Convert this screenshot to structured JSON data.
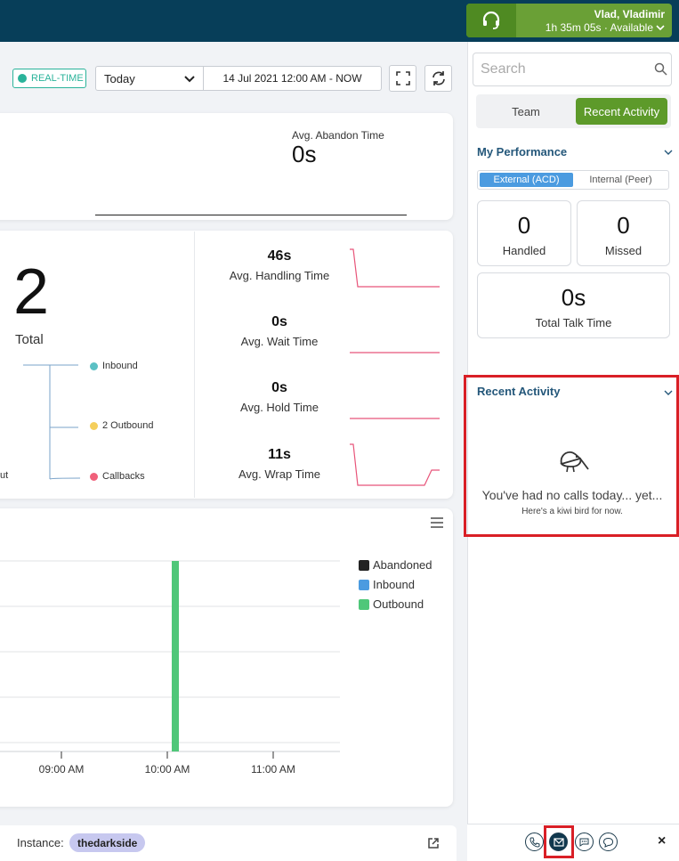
{
  "header": {
    "agent_name": "Vlad, Vladimir",
    "agent_status": "1h 35m 05s · Available"
  },
  "toolbar": {
    "realtime_label": "REAL-TIME",
    "date_preset": "Today",
    "date_range": "14 Jul 2021 12:00 AM - NOW"
  },
  "summary": {
    "abandon_label": "Avg. Abandon Time",
    "abandon_value": "0s"
  },
  "calls": {
    "total_value": "2",
    "total_label": "Total",
    "tree": {
      "inbound": "Inbound",
      "outbound": "2 Outbound",
      "callbacks": "Callbacks",
      "left_partial": "ut"
    },
    "metrics": [
      {
        "value": "46s",
        "label": "Avg. Handling Time"
      },
      {
        "value": "0s",
        "label": "Avg. Wait Time"
      },
      {
        "value": "0s",
        "label": "Avg. Hold Time"
      },
      {
        "value": "11s",
        "label": "Avg. Wrap Time"
      }
    ],
    "colors": {
      "inbound": "#5bc0c4",
      "outbound": "#f5cf5c",
      "callbacks": "#f0607a",
      "sparkline": "#e8557a"
    }
  },
  "chart_data": {
    "type": "bar",
    "categories": [
      "09:00 AM",
      "10:00 AM",
      "11:00 AM"
    ],
    "series": [
      {
        "name": "Abandoned",
        "values": [
          0,
          0,
          0
        ],
        "color": "#222222"
      },
      {
        "name": "Inbound",
        "values": [
          0,
          0,
          0
        ],
        "color": "#4b9be0"
      },
      {
        "name": "Outbound",
        "values": [
          0,
          2,
          0
        ],
        "color": "#4fc779"
      }
    ],
    "legend_position": "right",
    "grid": true
  },
  "footer": {
    "instance_label": "Instance:",
    "instance_name": "thedarkside"
  },
  "panel": {
    "search_placeholder": "Search",
    "tabs": {
      "team": "Team",
      "recent": "Recent Activity"
    },
    "my_performance": {
      "title": "My Performance",
      "toggle_external": "External (ACD)",
      "toggle_internal": "Internal (Peer)",
      "handled_value": "0",
      "handled_label": "Handled",
      "missed_value": "0",
      "missed_label": "Missed",
      "talk_value": "0s",
      "talk_label": "Total Talk Time"
    },
    "recent_activity": {
      "title": "Recent Activity",
      "empty_title": "You've had no calls today... yet...",
      "empty_subtitle": "Here's a kiwi bird for now."
    },
    "close_label": "×"
  }
}
